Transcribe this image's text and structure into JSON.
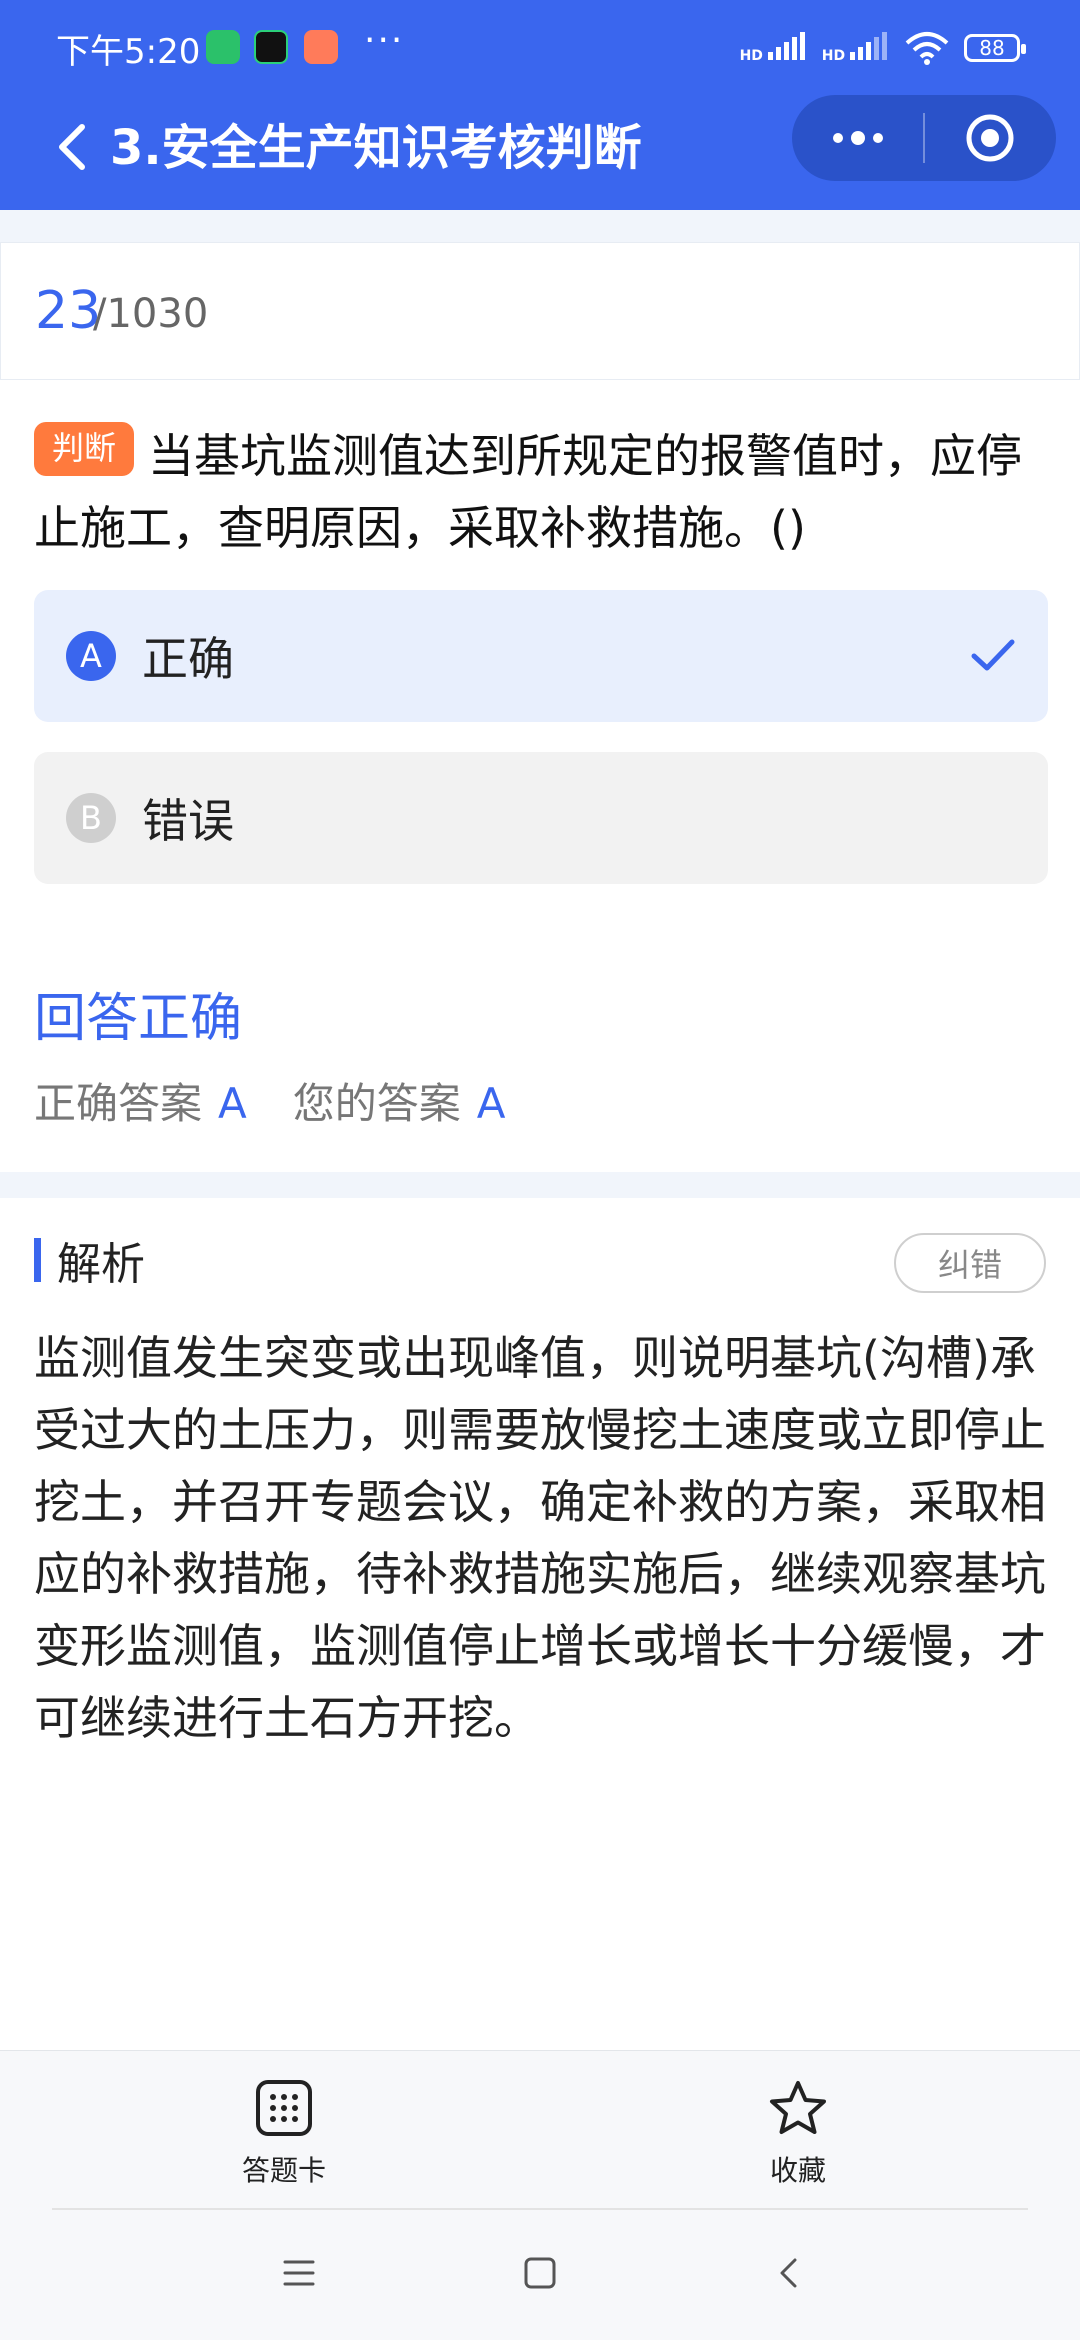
{
  "status_bar": {
    "time": "下午5:20",
    "more": "···",
    "network_1": "HD",
    "network_2": "HD",
    "battery": "88"
  },
  "header": {
    "title": "3.安全生产知识考核判断",
    "bg_color": "#3a66ee"
  },
  "progress": {
    "current": "23",
    "total": "/1030"
  },
  "question": {
    "type_tag": "判断",
    "text": "当基坑监测值达到所规定的报警值时，应停止施工，查明原因，采取补救措施。()"
  },
  "options": [
    {
      "letter": "A",
      "text": "正确",
      "selected": true
    },
    {
      "letter": "B",
      "text": "错误",
      "selected": false
    }
  ],
  "result": {
    "title": "回答正确",
    "correct_label": "正确答案",
    "correct_value": "A",
    "yours_label": "您的答案",
    "yours_value": "A"
  },
  "analysis": {
    "label": "解析",
    "report_button": "纠错",
    "text": "监测值发生突变或出现峰值，则说明基坑(沟槽)承受过大的土压力，则需要放慢挖土速度或立即停止挖土，并召开专题会议，确定补救的方案，采取相应的补救措施，待补救措施实施后，继续观察基坑变形监测值，监测值停止增长或增长十分缓慢，才可继续进行土石方开挖。"
  },
  "bottom_bar": {
    "answer_card": "答题卡",
    "favorite": "收藏"
  },
  "icons": {
    "back": "chevron-left-icon",
    "menu": "more-dots-icon",
    "close_app": "target-icon",
    "answer_card": "grid-icon",
    "favorite": "star-icon",
    "check": "check-icon"
  }
}
